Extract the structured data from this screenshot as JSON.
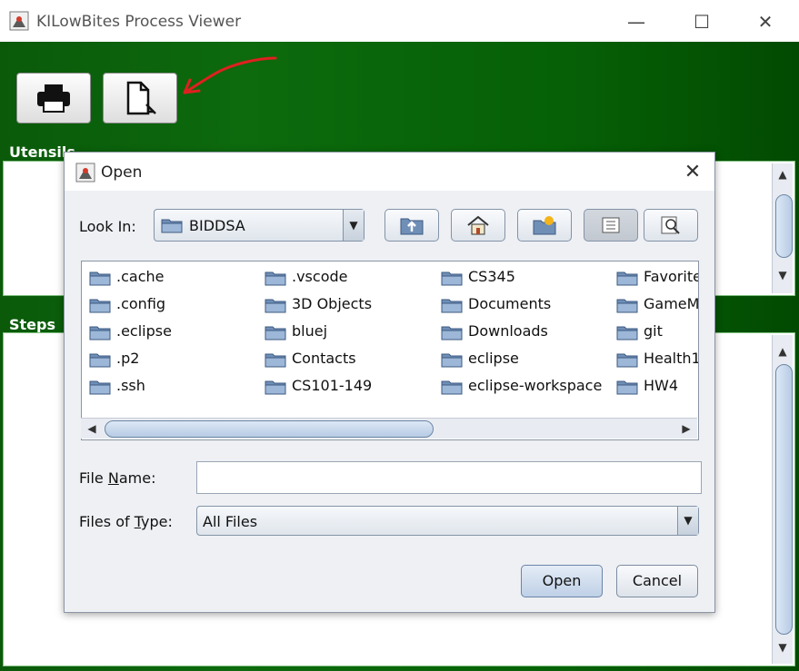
{
  "window": {
    "title": "KILowBites Process Viewer",
    "controls": {
      "minimize": "—",
      "maximize": "☐",
      "close": "✕"
    }
  },
  "toolbar": [
    {
      "name": "print-button",
      "icon": "printer-icon"
    },
    {
      "name": "open-file-button",
      "icon": "open-document-icon"
    }
  ],
  "sections": {
    "utensils_label": "Utensils",
    "steps_label": "Steps"
  },
  "colors": {
    "main_background": "#0a5a0a",
    "annotation_arrow": "#e02020"
  },
  "dialog": {
    "title": "Open",
    "look_in_label": "Look In:",
    "look_in_value": "BIDDSA",
    "nav_buttons": [
      "up-folder-icon",
      "home-icon",
      "new-folder-icon",
      "list-view-icon",
      "details-view-icon"
    ],
    "files": [
      ".cache",
      ".config",
      ".eclipse",
      ".p2",
      ".ssh",
      ".vscode",
      "3D Objects",
      "bluej",
      "Contacts",
      "CS101-149",
      "CS345",
      "Documents",
      "Downloads",
      "eclipse",
      "eclipse-workspace",
      "Favorites",
      "GameM",
      "git",
      "Health1",
      "HW4"
    ],
    "file_name_label": "File Name:",
    "file_name_value": "",
    "files_of_type_label": "Files of Type:",
    "files_of_type_value": "All Files",
    "open_label": "Open",
    "cancel_label": "Cancel"
  }
}
